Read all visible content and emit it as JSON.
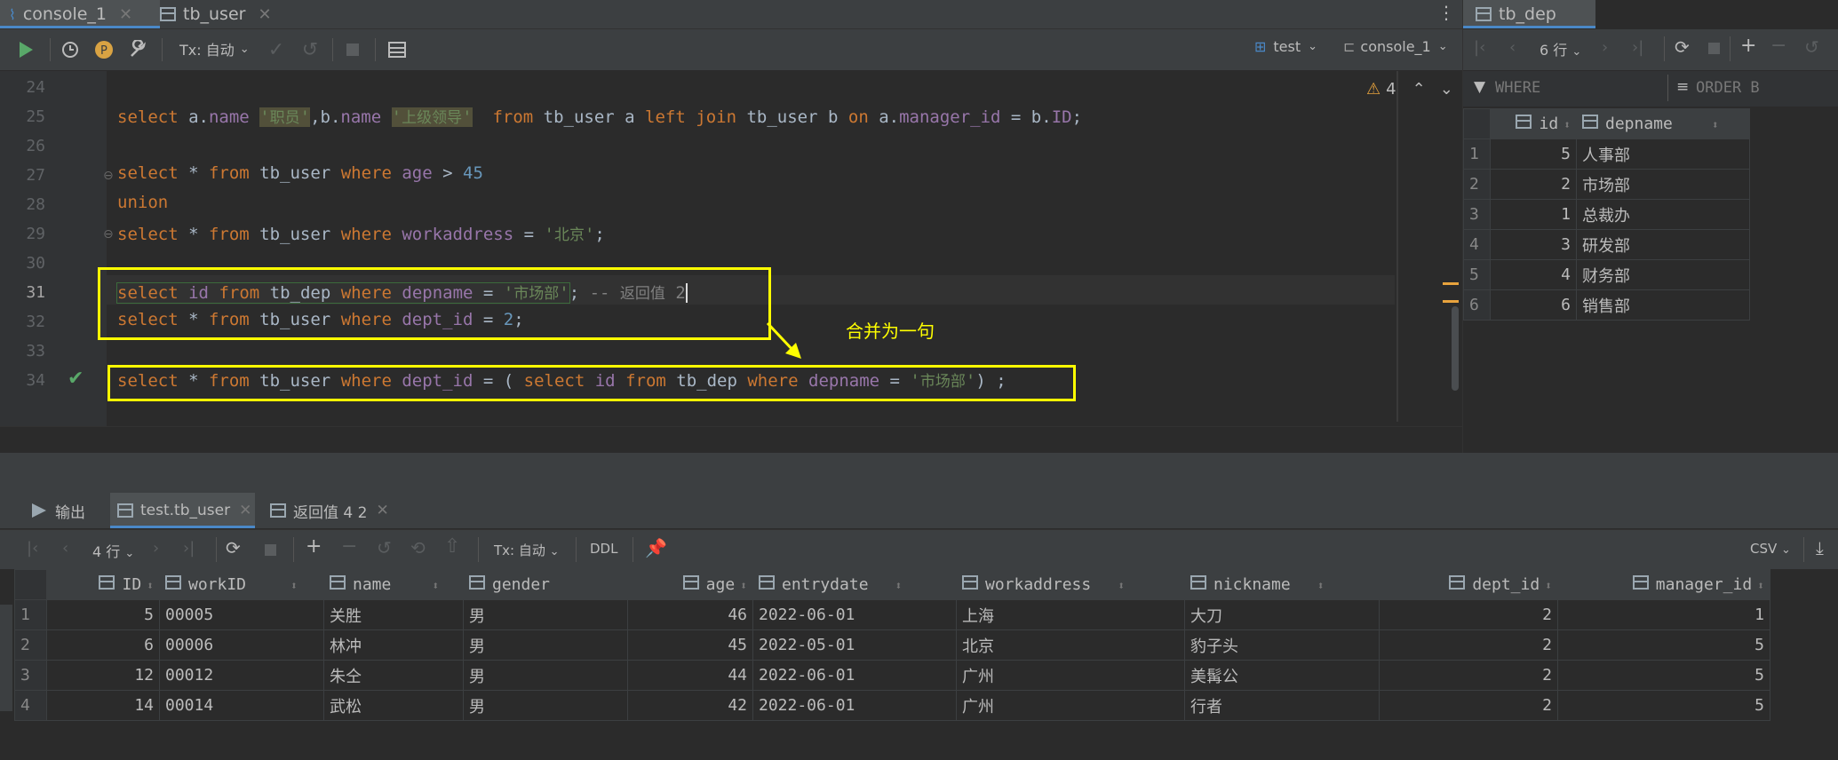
{
  "editor_tabs": [
    {
      "label": "console_1",
      "icon": "console-icon",
      "active": true
    },
    {
      "label": "tb_user",
      "icon": "table-icon",
      "active": false
    }
  ],
  "toolbar": {
    "tx_label": "Tx: 自动",
    "schema_label": "test",
    "session_label": "console_1"
  },
  "editor": {
    "warning_count": "4",
    "line_numbers": [
      "24",
      "25",
      "26",
      "27",
      "28",
      "29",
      "30",
      "31",
      "32",
      "33",
      "34"
    ]
  },
  "annotation": "合并为一句",
  "dep_panel": {
    "tab_label": "tb_dep",
    "row_count_label": "6 行",
    "filter_label": "WHERE",
    "order_label": "ORDER B",
    "columns": [
      "id",
      "depname"
    ],
    "rows": [
      [
        "1",
        "5",
        "人事部"
      ],
      [
        "2",
        "2",
        "市场部"
      ],
      [
        "3",
        "1",
        "总裁办"
      ],
      [
        "4",
        "3",
        "研发部"
      ],
      [
        "5",
        "4",
        "财务部"
      ],
      [
        "6",
        "6",
        "销售部"
      ]
    ]
  },
  "bottom": {
    "tabs": [
      {
        "label": "输出",
        "icon": "output-icon"
      },
      {
        "label": "test.tb_user",
        "icon": "table-icon",
        "active": true
      },
      {
        "label": "返回值 4 2",
        "icon": "table-icon"
      }
    ],
    "row_count_label": "4 行",
    "tx_label": "Tx: 自动",
    "ddl_label": "DDL",
    "export_label": "CSV",
    "columns": [
      "ID",
      "workID",
      "name",
      "gender",
      "age",
      "entrydate",
      "workaddress",
      "nickname",
      "dept_id",
      "manager_id"
    ],
    "rows": [
      [
        "1",
        "5",
        "00005",
        "关胜",
        "男",
        "46",
        "2022-06-01",
        "上海",
        "大刀",
        "2",
        "1"
      ],
      [
        "2",
        "6",
        "00006",
        "林冲",
        "男",
        "45",
        "2022-05-01",
        "北京",
        "豹子头",
        "2",
        "5"
      ],
      [
        "3",
        "12",
        "00012",
        "朱仝",
        "男",
        "44",
        "2022-06-01",
        "广州",
        "美髯公",
        "2",
        "5"
      ],
      [
        "4",
        "14",
        "00014",
        "武松",
        "男",
        "42",
        "2022-06-01",
        "广州",
        "行者",
        "2",
        "5"
      ]
    ]
  },
  "colors": {
    "keyword": "#cc7832",
    "column": "#9876aa",
    "string": "#6a8759",
    "number": "#6897bb",
    "highlight_box": "#ffff00"
  }
}
